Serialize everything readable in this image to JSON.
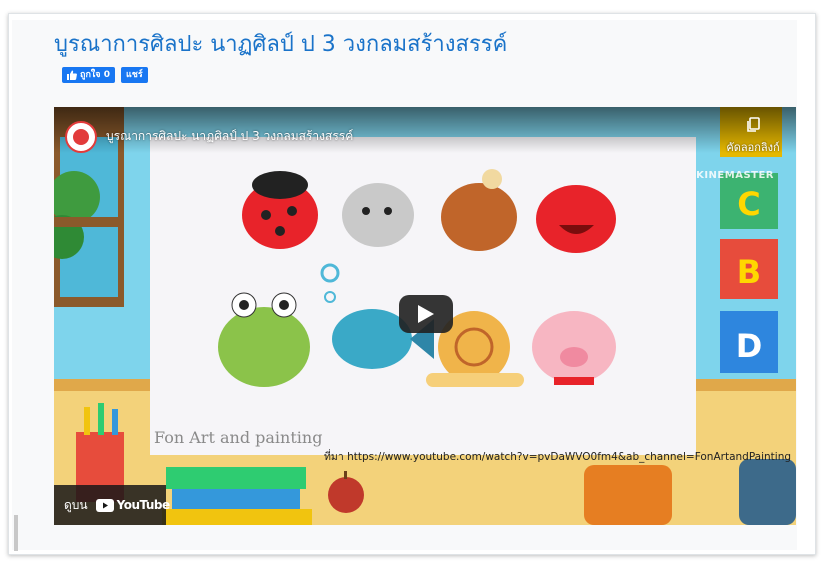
{
  "post": {
    "title": "บูรณาการศิลปะ นาฏศิลป์ ป 3 วงกลมสร้างสรรค์"
  },
  "social": {
    "like_label": "ถูกใจ 0",
    "share_label": "แชร์",
    "icons": [
      "thumbs-up-icon"
    ],
    "color": "#1877f2"
  },
  "video": {
    "title": "บูรณาการศิลปะ นาฏศิลป์ ป 3 วงกลมสร้างสรรค์",
    "copy_link_label": "คัดลอกลิงก์",
    "watermark": "KINEMASTER",
    "credit": "Fon Art and painting",
    "source": "ที่มา https://www.youtube.com/watch?v=pvDaWVO0fm4&ab_channel=FonArtandPainting",
    "blocks": [
      "C",
      "B",
      "D"
    ],
    "watch_on_label": "ดูบน",
    "youtube_label": "YouTube",
    "play_icon": "play-icon",
    "colors": {
      "youtube_red": "#ff0000",
      "title_blue": "#1a73c9",
      "play_button": "#212121"
    }
  }
}
